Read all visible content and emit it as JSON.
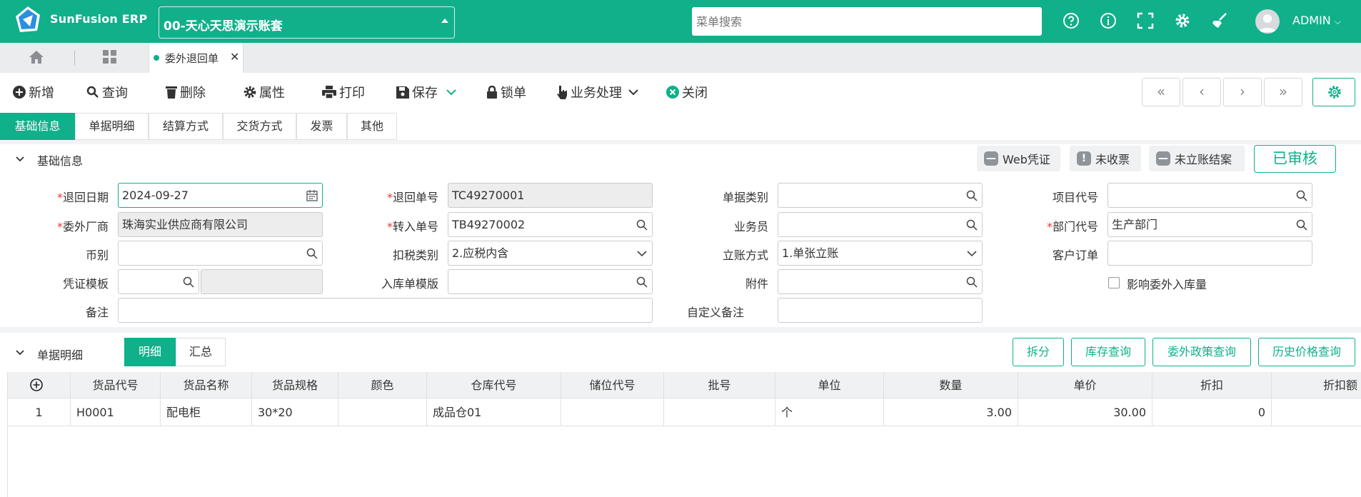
{
  "app": {
    "brand": "SunFusion ERP",
    "account": "00-天心天思演示账套",
    "search_placeholder": "菜单搜索",
    "user": "ADMIN",
    "accent": "#0fb08a"
  },
  "tabs": {
    "active": "委外退回单"
  },
  "toolbar": {
    "add": "新增",
    "query": "查询",
    "delete": "删除",
    "props": "属性",
    "print": "打印",
    "save": "保存",
    "lock": "锁单",
    "business": "业务处理",
    "close": "关闭"
  },
  "subtabs": [
    "基础信息",
    "单据明细",
    "结算方式",
    "交货方式",
    "发票",
    "其他"
  ],
  "basic": {
    "title": "基础信息",
    "chips": [
      "Web凭证",
      "未收票",
      "未立账结案"
    ],
    "audited": "已审核",
    "fields": {
      "return_date": {
        "label": "退回日期",
        "value": "2024-09-27"
      },
      "return_no": {
        "label": "退回单号",
        "value": "TC49270001"
      },
      "doc_type": {
        "label": "单据类别",
        "value": ""
      },
      "project_code": {
        "label": "项目代号",
        "value": ""
      },
      "vendor": {
        "label": "委外厂商",
        "value": "珠海实业供应商有限公司"
      },
      "transfer_no": {
        "label": "转入单号",
        "value": "TB49270002"
      },
      "salesman": {
        "label": "业务员",
        "value": ""
      },
      "dept_code": {
        "label": "部门代号",
        "value": "生产部门"
      },
      "currency": {
        "label": "币别",
        "value": ""
      },
      "tax_type": {
        "label": "扣税类别",
        "value": "2.应税内含"
      },
      "account_method": {
        "label": "立账方式",
        "value": "1.单张立账"
      },
      "customer_order": {
        "label": "客户订单",
        "value": ""
      },
      "voucher_tpl": {
        "label": "凭证模板",
        "value": "",
        "value2": ""
      },
      "stockin_tpl": {
        "label": "入库单模版",
        "value": ""
      },
      "attachment": {
        "label": "附件",
        "value": ""
      },
      "affect_stock": {
        "label": "影响委外入库量"
      },
      "remark": {
        "label": "备注",
        "value": ""
      },
      "custom_remark": {
        "label": "自定义备注",
        "value": ""
      }
    }
  },
  "detail": {
    "title": "单据明细",
    "views": [
      "明细",
      "汇总"
    ],
    "actions": [
      "拆分",
      "库存查询",
      "委外政策查询",
      "历史价格查询"
    ],
    "columns": [
      "货品代号",
      "货品名称",
      "货品规格",
      "颜色",
      "仓库代号",
      "储位代号",
      "批号",
      "单位",
      "数量",
      "单价",
      "折扣",
      "折扣额"
    ],
    "rows": [
      {
        "no": "1",
        "code": "H0001",
        "name": "配电柜",
        "spec": "30*20",
        "color": "",
        "warehouse": "成品仓01",
        "bin": "",
        "batch": "",
        "unit": "个",
        "qty": "3.00",
        "price": "30.00",
        "discount": "0",
        "discount_amt": ""
      }
    ]
  }
}
